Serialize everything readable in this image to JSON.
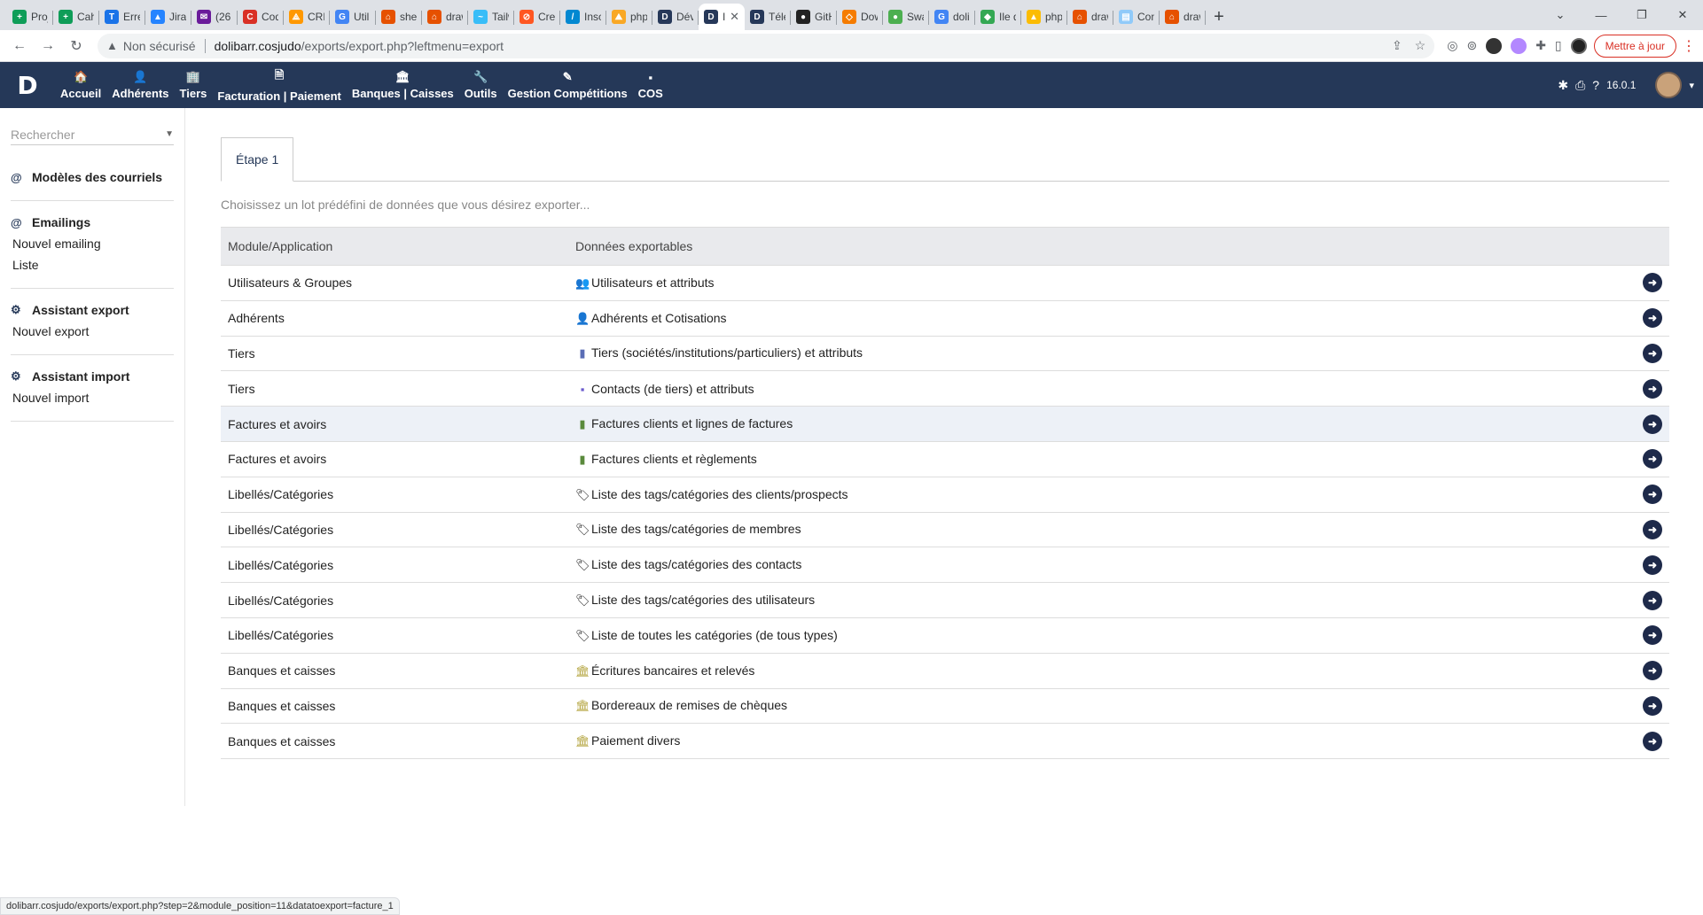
{
  "browser": {
    "tabs": [
      {
        "label": "Proj",
        "color": "#0f9d58",
        "glyph": "+"
      },
      {
        "label": "Cah",
        "color": "#0f9d58",
        "glyph": "+"
      },
      {
        "label": "Erre",
        "color": "#1a73e8",
        "glyph": "T"
      },
      {
        "label": "Jira",
        "color": "#2684ff",
        "glyph": "▲"
      },
      {
        "label": "(26",
        "color": "#6a1b9a",
        "glyph": "✉"
      },
      {
        "label": "Cod",
        "color": "#d93025",
        "glyph": "C"
      },
      {
        "label": "CRM",
        "color": "#ff9800",
        "glyph": "⟁"
      },
      {
        "label": "Util",
        "color": "#4285f4",
        "glyph": "G"
      },
      {
        "label": "sher",
        "color": "#e65100",
        "glyph": "⌂"
      },
      {
        "label": "draw",
        "color": "#e65100",
        "glyph": "⌂"
      },
      {
        "label": "Tailw",
        "color": "#38bdf8",
        "glyph": "~"
      },
      {
        "label": "Crea",
        "color": "#ff5722",
        "glyph": "⊘"
      },
      {
        "label": "Insc",
        "color": "#0288d1",
        "glyph": "/"
      },
      {
        "label": "php",
        "color": "#f9a825",
        "glyph": "⛰"
      },
      {
        "label": "Dév",
        "color": "#263859",
        "glyph": "D"
      },
      {
        "label": "I",
        "color": "#263859",
        "glyph": "D",
        "active": true
      },
      {
        "label": "Télé",
        "color": "#263859",
        "glyph": "D"
      },
      {
        "label": "GitH",
        "color": "#222222",
        "glyph": "●"
      },
      {
        "label": "Dow",
        "color": "#f57c00",
        "glyph": "◇"
      },
      {
        "label": "Swa",
        "color": "#4caf50",
        "glyph": "●"
      },
      {
        "label": "doli",
        "color": "#4285f4",
        "glyph": "G"
      },
      {
        "label": "Ile d",
        "color": "#34a853",
        "glyph": "◆"
      },
      {
        "label": "php",
        "color": "#fbbc04",
        "glyph": "▲"
      },
      {
        "label": "draw",
        "color": "#e65100",
        "glyph": "⌂"
      },
      {
        "label": "Con",
        "color": "#90caf9",
        "glyph": "▤"
      },
      {
        "label": "draw",
        "color": "#e65100",
        "glyph": "⌂"
      }
    ],
    "insecure_label": "Non sécurisé",
    "url_host": "dolibarr.cosjudo",
    "url_path": "/exports/export.php?leftmenu=export",
    "update_button": "Mettre à jour",
    "status_url": "dolibarr.cosjudo/exports/export.php?step=2&module_position=11&datatoexport=facture_1"
  },
  "topbar": {
    "logo": "D",
    "menu": [
      {
        "icon": "🏠",
        "label": "Accueil",
        "name": "menu-accueil"
      },
      {
        "icon": "👤",
        "label": "Adhérents",
        "name": "menu-adherents"
      },
      {
        "icon": "🏢",
        "label": "Tiers",
        "name": "menu-tiers"
      },
      {
        "icon": "🗎",
        "label": "Facturation | Paiement",
        "name": "menu-facturation"
      },
      {
        "icon": "🏛",
        "label": "Banques | Caisses",
        "name": "menu-banques"
      },
      {
        "icon": "🔧",
        "label": "Outils",
        "name": "menu-outils"
      },
      {
        "icon": "✎",
        "label": "Gestion Compétitions",
        "name": "menu-competitions"
      },
      {
        "icon": "▪",
        "label": "COS",
        "name": "menu-cos"
      }
    ],
    "version": "16.0.1"
  },
  "sidebar": {
    "search_placeholder": "Rechercher",
    "blocks": [
      {
        "icon": "@",
        "title": "Modèles des courriels",
        "links": []
      },
      {
        "icon": "@",
        "title": "Emailings",
        "links": [
          "Nouvel emailing",
          "Liste"
        ]
      },
      {
        "icon": "⚙",
        "title": "Assistant export",
        "links": [
          "Nouvel export"
        ]
      },
      {
        "icon": "⚙",
        "title": "Assistant import",
        "links": [
          "Nouvel import"
        ]
      }
    ]
  },
  "main": {
    "tab_label": "Étape 1",
    "intro": "Choisissez un lot prédéfini de données que vous désirez exporter...",
    "columns": [
      "Module/Application",
      "Données exportables"
    ],
    "rows": [
      {
        "module": "Utilisateurs & Groupes",
        "icon": "👥",
        "icon_color": "#555555",
        "data": "Utilisateurs et attributs"
      },
      {
        "module": "Adhérents",
        "icon": "👤",
        "icon_color": "#7a5c3e",
        "data": "Adhérents et Cotisations"
      },
      {
        "module": "Tiers",
        "icon": "▮",
        "icon_color": "#5a6db5",
        "data": "Tiers (sociétés/institutions/particuliers) et attributs"
      },
      {
        "module": "Tiers",
        "icon": "▪",
        "icon_color": "#6a5acd",
        "data": "Contacts (de tiers) et attributs"
      },
      {
        "module": "Factures et avoirs",
        "icon": "▮",
        "icon_color": "#5a8a3c",
        "data": "Factures clients et lignes de factures",
        "highlight": true
      },
      {
        "module": "Factures et avoirs",
        "icon": "▮",
        "icon_color": "#5a8a3c",
        "data": "Factures clients et règlements"
      },
      {
        "module": "Libellés/Catégories",
        "icon": "🏷",
        "icon_color": "#222222",
        "data": "Liste des tags/catégories des clients/prospects"
      },
      {
        "module": "Libellés/Catégories",
        "icon": "🏷",
        "icon_color": "#222222",
        "data": "Liste des tags/catégories de membres"
      },
      {
        "module": "Libellés/Catégories",
        "icon": "🏷",
        "icon_color": "#222222",
        "data": "Liste des tags/catégories des contacts"
      },
      {
        "module": "Libellés/Catégories",
        "icon": "🏷",
        "icon_color": "#222222",
        "data": "Liste des tags/catégories des utilisateurs"
      },
      {
        "module": "Libellés/Catégories",
        "icon": "🏷",
        "icon_color": "#222222",
        "data": "Liste de toutes les catégories (de tous types)"
      },
      {
        "module": "Banques et caisses",
        "icon": "🏛",
        "icon_color": "#b5a642",
        "data": "Écritures bancaires et relevés"
      },
      {
        "module": "Banques et caisses",
        "icon": "🏛",
        "icon_color": "#b5a642",
        "data": "Bordereaux de remises de chèques"
      },
      {
        "module": "Banques et caisses",
        "icon": "🏛",
        "icon_color": "#b5a642",
        "data": "Paiement divers"
      }
    ]
  }
}
